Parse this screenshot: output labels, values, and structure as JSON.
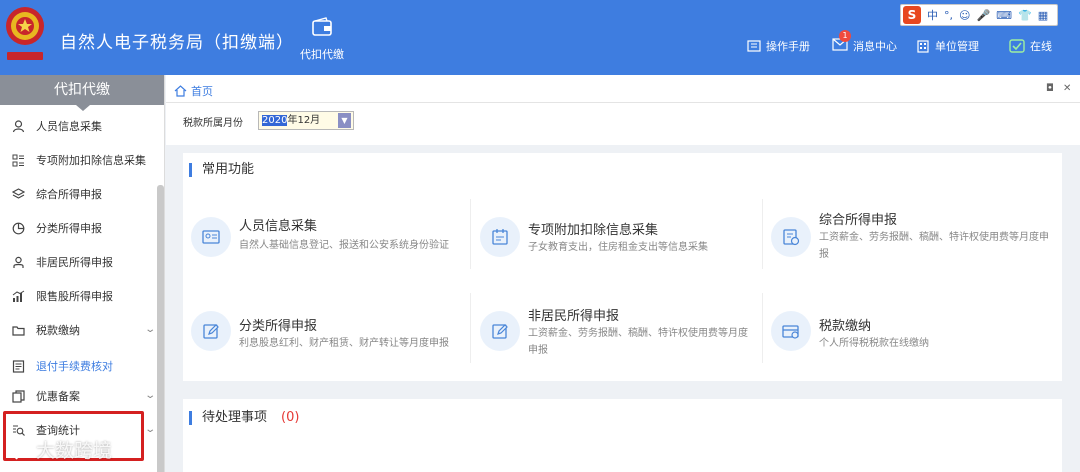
{
  "header": {
    "app_title": "自然人电子税务局（扣缴端）",
    "nav_tab_label": "代扣代缴",
    "links": [
      {
        "label": "操作手册",
        "icon": "manual-icon"
      },
      {
        "label": "消息中心",
        "icon": "mail-icon",
        "badge": "1"
      },
      {
        "label": "单位管理",
        "icon": "building-icon"
      },
      {
        "label": "在线",
        "icon": "online-status-icon"
      }
    ],
    "colors": {
      "header_bg": "#3e7de0",
      "accent": "#3e7de0",
      "highlight_box": "#d42020",
      "badge": "#f04a3e"
    }
  },
  "ime_toolbar": {
    "logo": "S",
    "items": [
      "中",
      "°,",
      "☺",
      "🎤",
      "⌨",
      "👕",
      "▦"
    ]
  },
  "sidebar": {
    "header": "代扣代缴",
    "items": [
      {
        "label": "人员信息采集",
        "icon": "person-icon"
      },
      {
        "label": "专项附加扣除信息采集",
        "icon": "list-grid-icon"
      },
      {
        "label": "综合所得申报",
        "icon": "layers-icon"
      },
      {
        "label": "分类所得申报",
        "icon": "pie-clock-icon"
      },
      {
        "label": "非居民所得申报",
        "icon": "user-outline-icon"
      },
      {
        "label": "限售股所得申报",
        "icon": "bar-chart-icon"
      },
      {
        "label": "税款缴纳",
        "icon": "folder-icon",
        "chevron": true
      },
      {
        "label": "退付手续费核对",
        "icon": "document-icon",
        "active": true
      },
      {
        "label": "优惠备案",
        "icon": "copy-icon",
        "chevron": true
      },
      {
        "label": "查询统计",
        "icon": "search-list-icon",
        "chevron": true
      }
    ]
  },
  "breadcrumb": {
    "home": "首页"
  },
  "filter": {
    "label": "税款所属月份",
    "value_selected": "2020",
    "value_rest": "年12月"
  },
  "common_functions": {
    "title": "常用功能",
    "cards": [
      {
        "title": "人员信息采集",
        "desc": "自然人基础信息登记、报送和公安系统身份验证",
        "icon": "id-card-icon"
      },
      {
        "title": "专项附加扣除信息采集",
        "desc": "子女教育支出，住房租金支出等信息采集",
        "icon": "calendar-doc-icon"
      },
      {
        "title": "综合所得申报",
        "desc": "工资薪金、劳务报酬、稿酬、特许权使用费等月度申报",
        "icon": "tax-form-icon"
      },
      {
        "title": "分类所得申报",
        "desc": "利息股息红利、财产租赁、财产转让等月度申报",
        "icon": "edit-icon"
      },
      {
        "title": "非居民所得申报",
        "desc": "工资薪金、劳务报酬、稿酬、特许权使用费等月度申报",
        "icon": "edit-icon"
      },
      {
        "title": "税款缴纳",
        "desc": "个人所得税税款在线缴纳",
        "icon": "payment-card-icon"
      }
    ]
  },
  "pending": {
    "title": "待处理事项",
    "count": "(0)"
  },
  "watermark": "大数跨境"
}
